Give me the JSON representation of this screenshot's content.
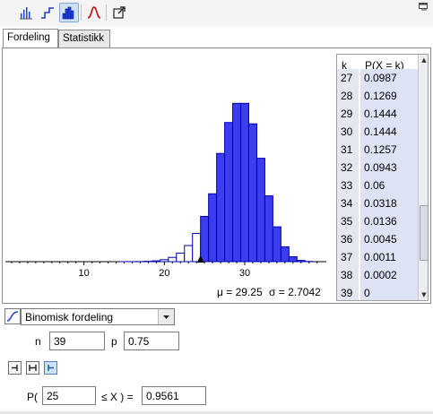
{
  "toolbar": {
    "icons": [
      "bar-chart-icon",
      "step-chart-icon",
      "histogram-icon",
      "normal-curve-icon",
      "export-icon"
    ],
    "active": "histogram-icon",
    "accent": "#1f3fd6"
  },
  "tabs": [
    {
      "label": "Fordeling",
      "active": true
    },
    {
      "label": "Statistikk",
      "active": false
    }
  ],
  "chart_data": {
    "type": "bar",
    "x": [
      15,
      16,
      17,
      18,
      19,
      20,
      21,
      22,
      23,
      24,
      25,
      26,
      27,
      28,
      29,
      30,
      31,
      32,
      33,
      34,
      35,
      36,
      37,
      38,
      39
    ],
    "values": [
      1e-05,
      4e-05,
      0.00011,
      0.0003,
      0.00076,
      0.0018,
      0.0039,
      0.0078,
      0.0147,
      0.0257,
      0.0413,
      0.0619,
      0.0987,
      0.1269,
      0.1444,
      0.1444,
      0.1257,
      0.0943,
      0.06,
      0.0318,
      0.0136,
      0.0045,
      0.0011,
      0.0002,
      0
    ],
    "highlight_from": 25,
    "xticks": [
      "10",
      "20",
      "30"
    ],
    "xlim": [
      0,
      40
    ],
    "ylim": [
      0,
      0.17
    ],
    "bar_color": "#3d3df0",
    "bar_edge": "#0000aa",
    "annotation": {
      "mean": "μ = 29.25",
      "sd": "σ = 2.7042"
    }
  },
  "table": {
    "headers": {
      "k": "k",
      "p": "P(X = k)"
    },
    "rows": [
      {
        "k": "27",
        "p": "0.0987"
      },
      {
        "k": "28",
        "p": "0.1269"
      },
      {
        "k": "29",
        "p": "0.1444"
      },
      {
        "k": "30",
        "p": "0.1444"
      },
      {
        "k": "31",
        "p": "0.1257"
      },
      {
        "k": "32",
        "p": "0.0943"
      },
      {
        "k": "33",
        "p": "0.06"
      },
      {
        "k": "34",
        "p": "0.0318"
      },
      {
        "k": "35",
        "p": "0.0136"
      },
      {
        "k": "36",
        "p": "0.0045"
      },
      {
        "k": "37",
        "p": "0.0011"
      },
      {
        "k": "38",
        "p": "0.0002"
      },
      {
        "k": "39",
        "p": "0"
      }
    ]
  },
  "distribution": {
    "selected": "Binomisk fordeling",
    "n_label": "n",
    "n_value": "39",
    "p_label": "p",
    "p_value": "0.75"
  },
  "probability": {
    "prefix": "P(",
    "lower": "25",
    "middle": "≤ X ) =",
    "result": "0.9561",
    "mode_buttons": [
      "left-sided-icon",
      "interval-icon",
      "right-sided-icon"
    ],
    "active_mode": "right-sided-icon"
  }
}
